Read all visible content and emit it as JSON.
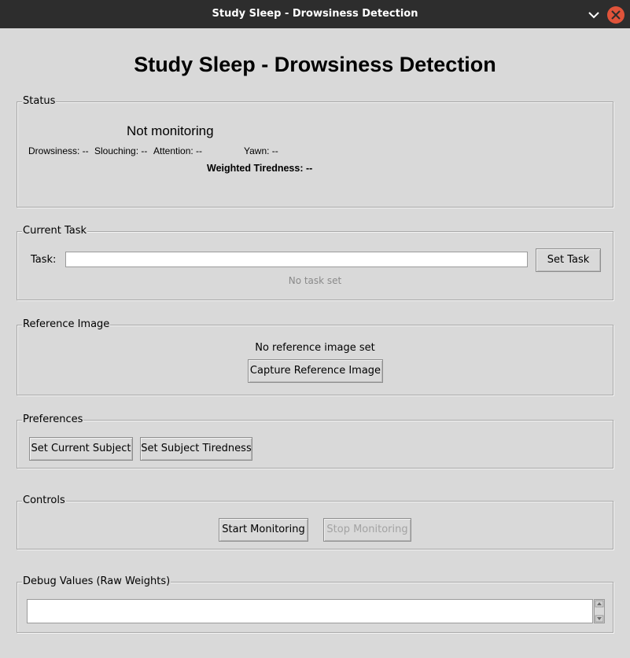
{
  "window": {
    "title": "Study Sleep - Drowsiness Detection"
  },
  "app": {
    "heading": "Study Sleep - Drowsiness Detection"
  },
  "status": {
    "legend": "Status",
    "state": "Not monitoring",
    "drowsiness": "Drowsiness: --",
    "slouching": "Slouching: --",
    "attention": "Attention: --",
    "yawn": "Yawn: --",
    "weighted": "Weighted Tiredness: --"
  },
  "task": {
    "legend": "Current Task",
    "label": "Task:",
    "value": "",
    "set_button": "Set Task",
    "info": "No task set"
  },
  "reference": {
    "legend": "Reference Image",
    "info": "No reference image set",
    "capture_button": "Capture Reference Image"
  },
  "preferences": {
    "legend": "Preferences",
    "subject_button": "Set Current Subject",
    "tiredness_button": "Set Subject Tiredness"
  },
  "controls": {
    "legend": "Controls",
    "start_button": "Start Monitoring",
    "stop_button": "Stop Monitoring"
  },
  "debug": {
    "legend": "Debug Values (Raw Weights)",
    "value": ""
  },
  "colors": {
    "background": "#d9d9d9",
    "titlebar": "#2d2d2d",
    "close": "#e0533a",
    "disabled_text": "#a3a3a3",
    "info_text": "#8a8a8a"
  },
  "icons": {
    "minimize": "chevron-down-icon",
    "close": "close-icon"
  }
}
